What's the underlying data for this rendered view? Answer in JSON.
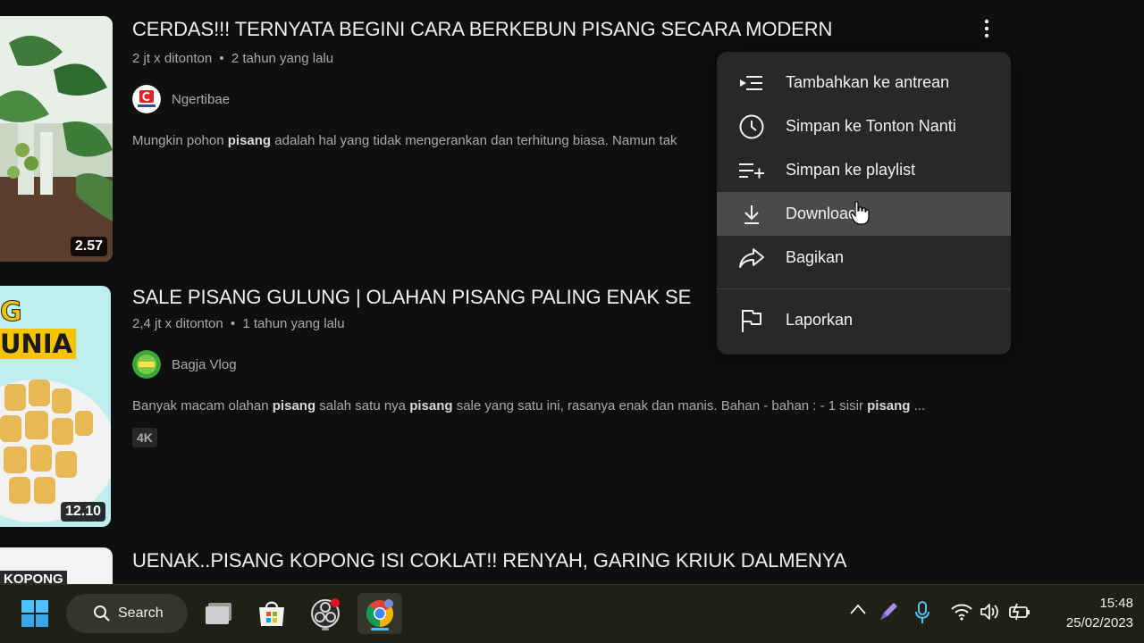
{
  "videos": [
    {
      "title": "CERDAS!!! TERNYATA BEGINI CARA BERKEBUN PISANG SECARA MODERN",
      "views": "2 jt x ditonton",
      "age": "2 tahun yang lalu",
      "channel": "Ngertibae",
      "desc_parts": [
        "Mungkin pohon ",
        "pisang",
        " adalah hal yang tidak mengerankan dan terhitung biasa. Namun tak"
      ],
      "duration": "2.57"
    },
    {
      "title": "SALE PISANG GULUNG | OLAHAN PISANG PALING ENAK SE",
      "views": "2,4 jt x ditonton",
      "age": "1 tahun yang lalu",
      "channel": "Bagja Vlog",
      "desc_parts": [
        "Banyak macam olahan ",
        "pisang",
        " salah satu nya ",
        "pisang",
        " sale yang satu ini, rasanya enak dan manis. Bahan - bahan : - 1 sisir ",
        "pisang",
        " ..."
      ],
      "badge": "4K",
      "duration": "12.10",
      "thumb_text_top": "G",
      "thumb_text": "UNIA"
    },
    {
      "title": "UENAK..PISANG KOPONG ISI COKLAT!! RENYAH, GARING KRIUK DALMENYA",
      "thumb_text": "KOPONG"
    }
  ],
  "separator": "•",
  "menu": {
    "items": [
      {
        "label": "Tambahkan ke antrean",
        "icon": "add-to-queue-icon"
      },
      {
        "label": "Simpan ke Tonton Nanti",
        "icon": "clock-icon"
      },
      {
        "label": "Simpan ke playlist",
        "icon": "playlist-add-icon"
      },
      {
        "label": "Download",
        "icon": "download-icon",
        "active": true
      },
      {
        "label": "Bagikan",
        "icon": "share-icon"
      },
      {
        "label": "Laporkan",
        "icon": "flag-icon"
      }
    ]
  },
  "taskbar": {
    "search_label": "Search",
    "time": "15:48",
    "date": "25/02/2023"
  },
  "colors": {
    "background": "#0f0f0f",
    "menu_bg": "#282828",
    "menu_active": "#4a4a4a",
    "secondary_text": "#aaaaaa",
    "taskbar_bg": "#1f2115"
  }
}
